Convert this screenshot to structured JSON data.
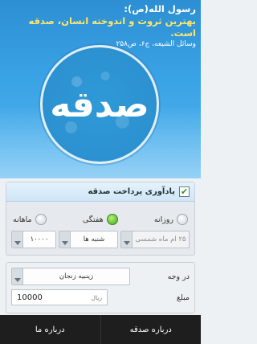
{
  "header": {
    "quote_line1": "رسول الله(ص):",
    "quote_line2": "بهترین ثروت و اندوخته انسان، صدقه است.",
    "quote_source": "وسائل الشیعه، ج۶، ص۲۵۸",
    "seal_text": "صدقه"
  },
  "reminder": {
    "title": "یادآوری پرداخت صدقه",
    "checked": true,
    "options": [
      {
        "label": "ماهانه",
        "selected": false
      },
      {
        "label": "هفتگی",
        "selected": true
      },
      {
        "label": "روزانه",
        "selected": false
      }
    ],
    "amount_select": "۱۰۰۰۰",
    "day_select": "شنبه ها",
    "month_select": "۲۵ ام ماه شمسی"
  },
  "donation": {
    "target_label": "در وجه",
    "target_value": "زینبیه زنجان",
    "amount_label": "مبلغ",
    "amount_value": "10000",
    "currency": "ریال"
  },
  "bottom_bar": {
    "about_us": "درباره ما",
    "about_sadaqa": "درباره صدقه"
  }
}
